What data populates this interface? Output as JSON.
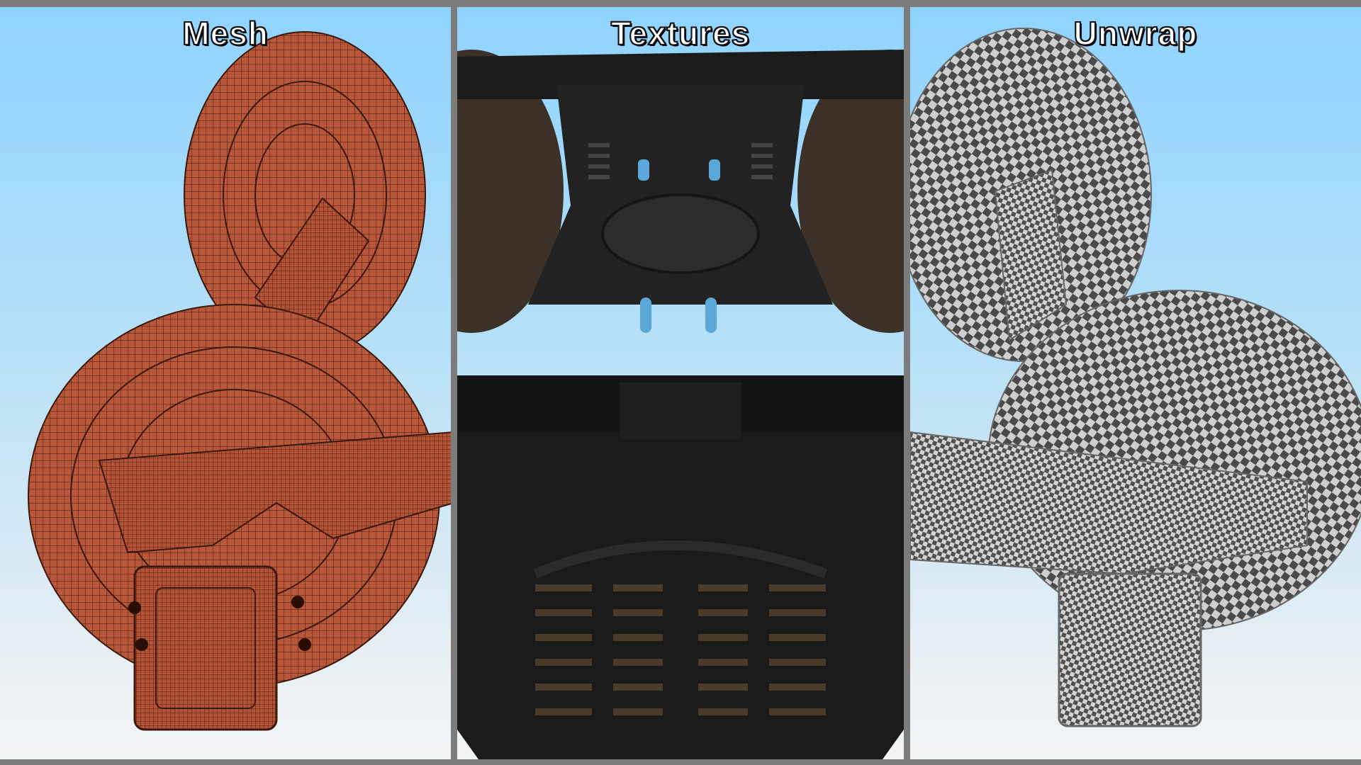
{
  "panels": [
    {
      "title": "Mesh"
    },
    {
      "title": "Textures"
    },
    {
      "title": "Unwrap"
    }
  ],
  "colors": {
    "background_frame": "#7c7c7c",
    "sky_top": "#8fd3ff",
    "sky_bottom": "#f3f5f6",
    "mesh_fill": "#b9573a",
    "mesh_wire": "#3a170c",
    "texture_body": "#1e1e1e",
    "checker_dark": "#4a4a4a",
    "checker_light": "#cfcfcf",
    "title_text": "#ffffff",
    "title_outline": "#000000"
  }
}
